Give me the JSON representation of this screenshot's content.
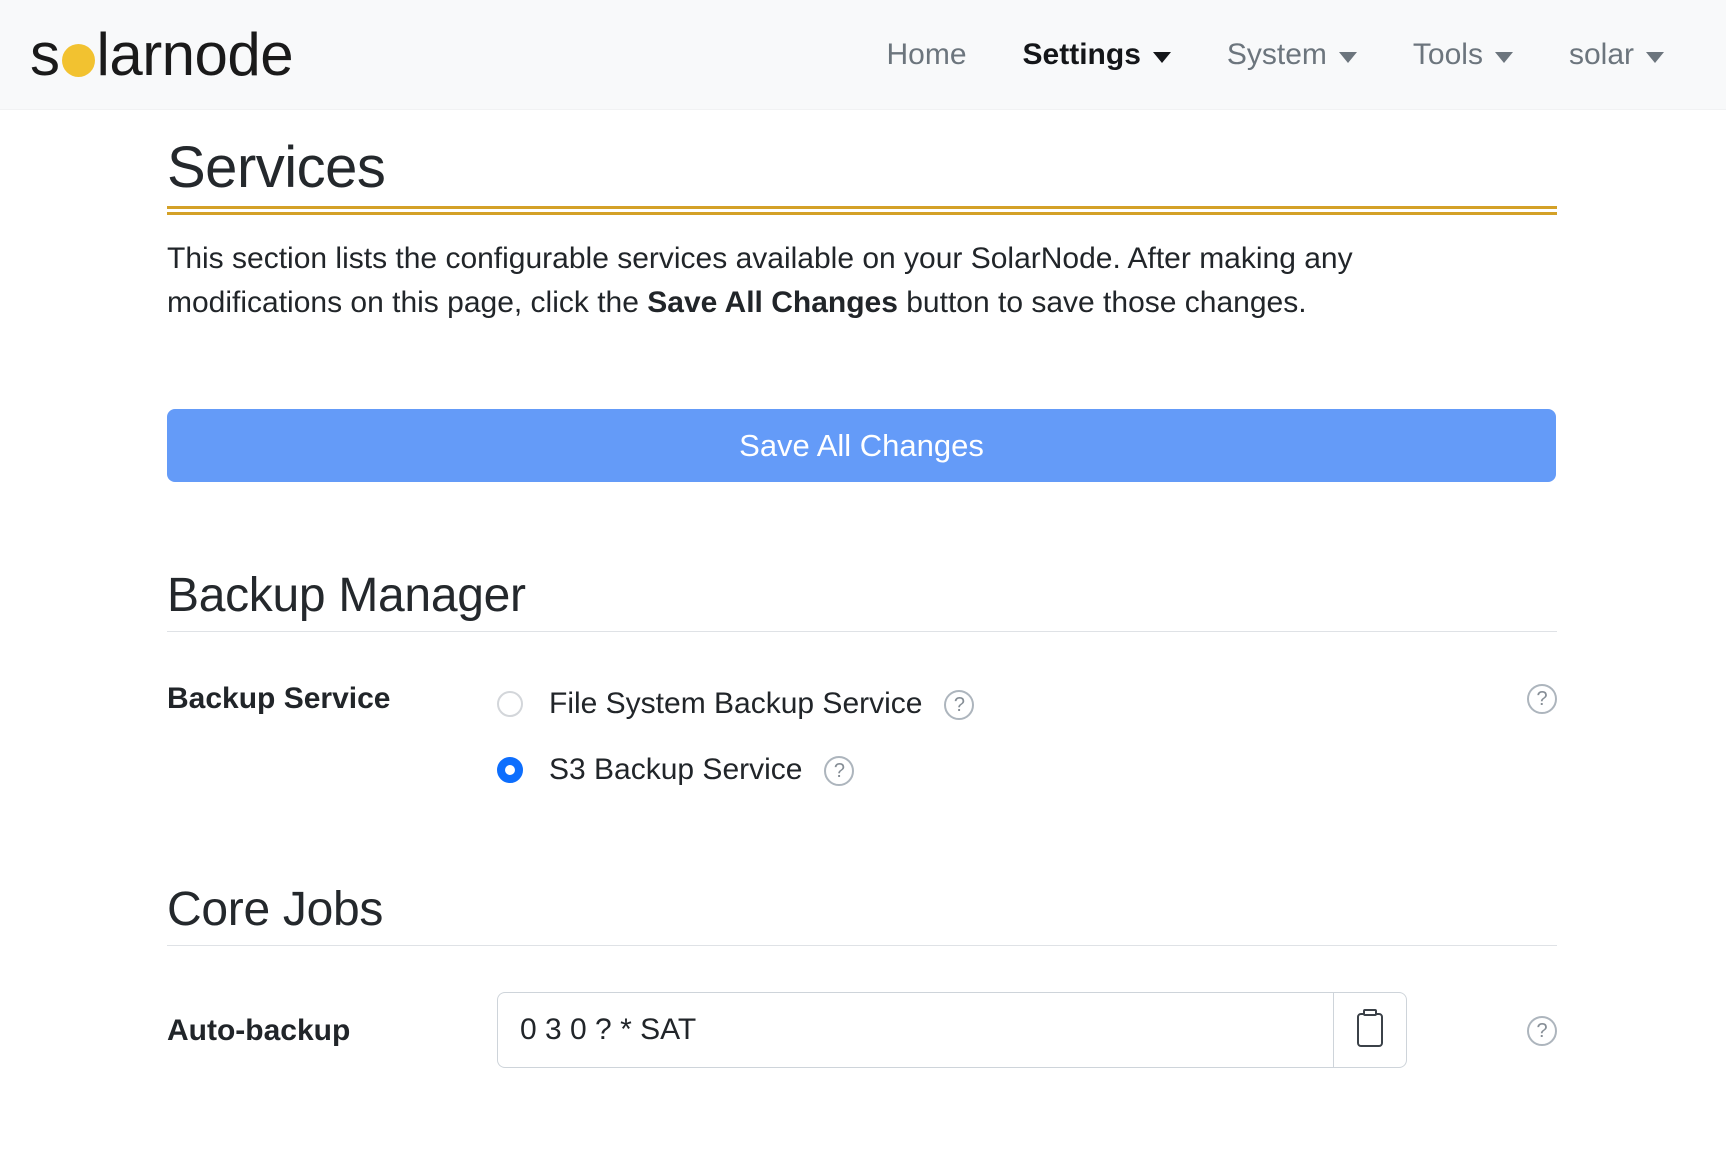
{
  "navbar": {
    "brand": {
      "pre": "s",
      "dot_icon": "sun-dot-icon",
      "post": "larnode",
      "full": "solarnode"
    },
    "items": [
      {
        "label": "Home",
        "has_caret": false,
        "active": false
      },
      {
        "label": "Settings",
        "has_caret": true,
        "active": true
      },
      {
        "label": "System",
        "has_caret": true,
        "active": false
      },
      {
        "label": "Tools",
        "has_caret": true,
        "active": false
      },
      {
        "label": "solar",
        "has_caret": true,
        "active": false
      }
    ]
  },
  "page": {
    "title": "Services",
    "intro_part1": "This section lists the configurable services available on your SolarNode. After making any modifications on this page, click the ",
    "intro_strong": "Save All Changes",
    "intro_part2": " button to save those changes.",
    "save_all_label": "Save All Changes"
  },
  "backup_manager": {
    "heading": "Backup Manager",
    "backup_service": {
      "label": "Backup Service",
      "options": [
        {
          "label": "File System Backup Service",
          "selected": false,
          "help": "?"
        },
        {
          "label": "S3 Backup Service",
          "selected": true,
          "help": "?"
        }
      ],
      "row_help": "?"
    }
  },
  "core_jobs": {
    "heading": "Core Jobs",
    "auto_backup": {
      "label": "Auto-backup",
      "value": "0 3 0 ? * SAT",
      "placeholder": "",
      "copy_icon": "clipboard-icon",
      "row_help": "?"
    }
  },
  "colors": {
    "accent_gold": "#d4a127",
    "primary_blue": "#649bf8",
    "radio_blue": "#0d6efd",
    "navbar_bg": "#f8f9fa",
    "logo_dot": "#f2c230"
  }
}
